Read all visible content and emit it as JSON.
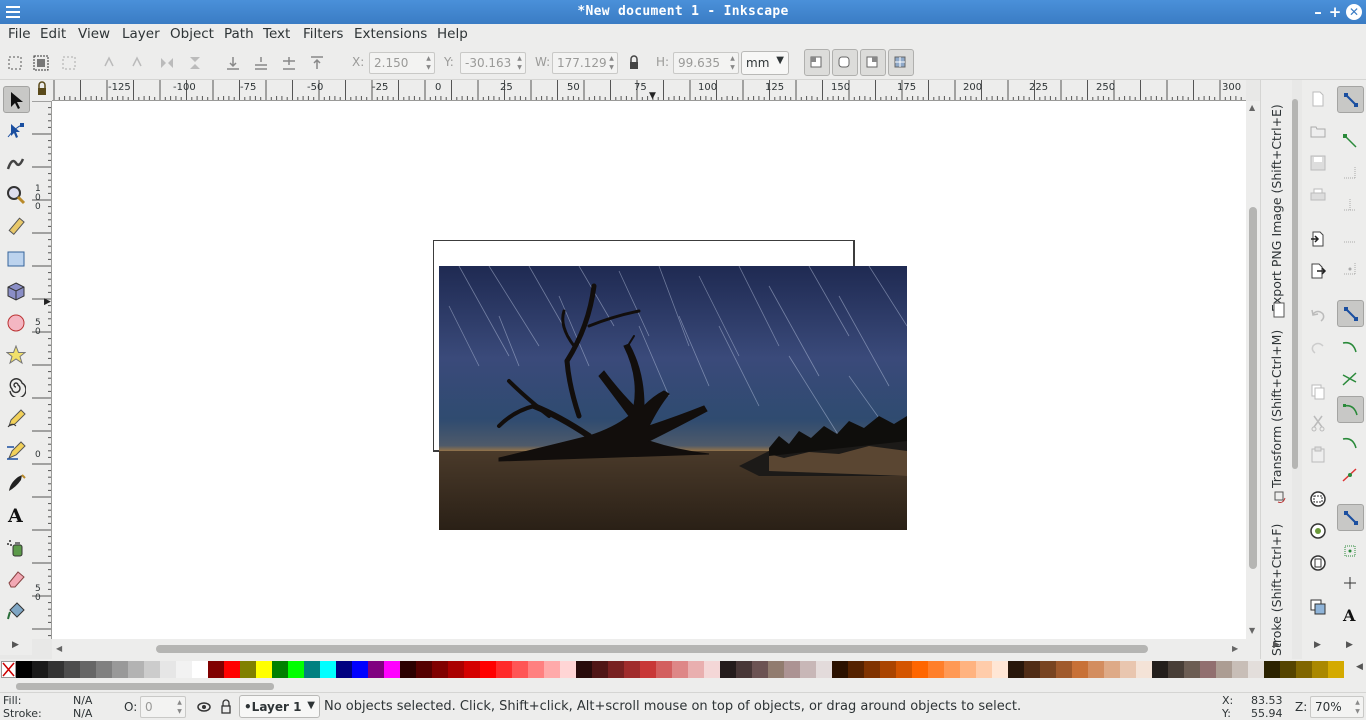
{
  "window": {
    "title": "*New document 1 - Inkscape"
  },
  "menu": [
    "File",
    "Edit",
    "View",
    "Layer",
    "Object",
    "Path",
    "Text",
    "Filters",
    "Extensions",
    "Help"
  ],
  "controls": {
    "x_label": "X:",
    "x_value": "2.150",
    "y_label": "Y:",
    "y_value": "-30.163",
    "w_label": "W:",
    "w_value": "177.129",
    "h_label": "H:",
    "h_value": "99.635",
    "unit": "mm"
  },
  "ruler": {
    "top_labels": [
      "-125",
      "-100",
      "-75",
      "-50",
      "-25",
      "0",
      "25",
      "50",
      "75",
      "100",
      "125",
      "150",
      "175",
      "200",
      "225",
      "250",
      "300"
    ],
    "left_labels": [
      "1\n0\n0",
      "5\n0",
      "0",
      "5\n0"
    ]
  },
  "dock": {
    "tabs": [
      "Export PNG Image (Shift+Ctrl+E)",
      "Transform (Shift+Ctrl+M)",
      "Stroke (Shift+Ctrl+F)"
    ]
  },
  "status": {
    "fill_label": "Fill:",
    "fill_value": "N/A",
    "stroke_label": "Stroke:",
    "stroke_value": "N/A",
    "opacity_label": "O:",
    "opacity_value": "0",
    "layer": "•Layer 1",
    "message": "No objects selected. Click, Shift+click, Alt+scroll mouse on top of objects, or drag around objects to select.",
    "x_label": "X:",
    "x_value": "83.53",
    "y_label": "Y:",
    "y_value": "55.94",
    "zoom_label": "Z:",
    "zoom_value": "70%"
  },
  "colors": {
    "titlebar": "#3a7cc4",
    "palette": [
      "#000000",
      "#1a1a1a",
      "#333333",
      "#4d4d4d",
      "#666666",
      "#808080",
      "#999999",
      "#b3b3b3",
      "#cccccc",
      "#e6e6e6",
      "#f2f2f2",
      "#ffffff",
      "#800000",
      "#ff0000",
      "#808000",
      "#ffff00",
      "#008000",
      "#00ff00",
      "#008080",
      "#00ffff",
      "#000080",
      "#0000ff",
      "#800080",
      "#ff00ff",
      "#2b0000",
      "#550000",
      "#800000",
      "#aa0000",
      "#d40000",
      "#ff0000",
      "#ff2a2a",
      "#ff5555",
      "#ff8080",
      "#ffaaaa",
      "#ffd5d5",
      "#280b0b",
      "#501616",
      "#782121",
      "#a02c2c",
      "#c83737",
      "#d35f5f",
      "#de8787",
      "#e9afaf",
      "#f4d7d7",
      "#241c1c",
      "#483737",
      "#6c5353",
      "#917c6f",
      "#ac9393",
      "#c8b7b7",
      "#e3dbdb",
      "#2b1100",
      "#552200",
      "#803300",
      "#aa4400",
      "#d45500",
      "#ff6600",
      "#ff7f2a",
      "#ff9955",
      "#ffb380",
      "#ffccaa",
      "#ffe6d5",
      "#28170b",
      "#502d16",
      "#784421",
      "#a05a2c",
      "#c87137",
      "#d38d5f",
      "#deaa87",
      "#e9c6af",
      "#f4e3d7",
      "#241f1c",
      "#483e37",
      "#6c5d53",
      "#916f6f",
      "#ac9d93",
      "#c8beb7",
      "#e3dedb",
      "#2b2200",
      "#554400",
      "#806600",
      "#aa8800",
      "#d4aa00"
    ]
  }
}
